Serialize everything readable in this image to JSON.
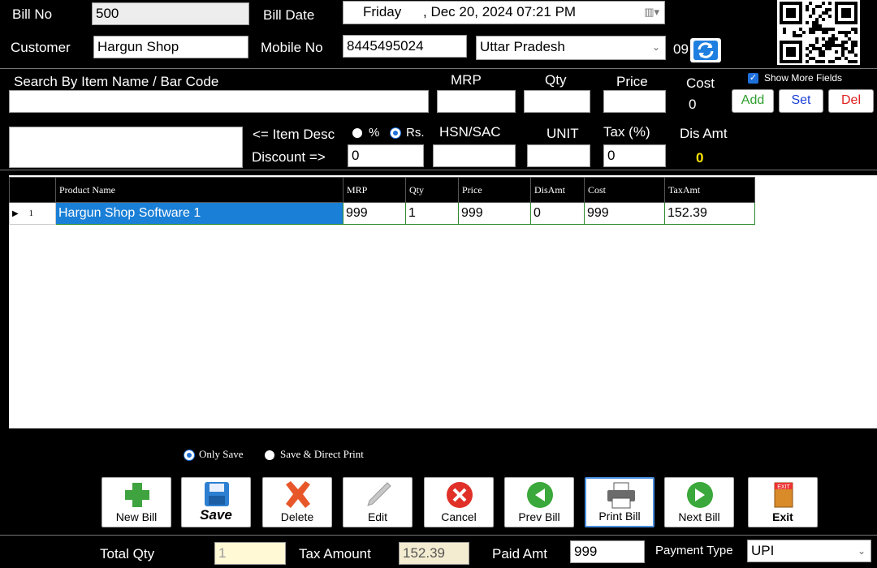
{
  "header": {
    "bill_no_label": "Bill No",
    "bill_no": "500",
    "bill_date_label": "Bill Date",
    "bill_day": "Friday",
    "bill_date": ", Dec 20, 2024 07:21 PM",
    "customer_label": "Customer",
    "customer": "Hargun Shop",
    "mobile_label": "Mobile No",
    "mobile": "8445495024",
    "state": "Uttar Pradesh",
    "state_code": "09"
  },
  "item_entry": {
    "search_label": "Search By Item Name /  Bar Code",
    "mrp_label": "MRP",
    "qty_label": "Qty",
    "price_label": "Price",
    "cost_label": "Cost",
    "cost_value": "0",
    "show_more_label": "Show More Fields",
    "add_label": "Add",
    "set_label": "Set",
    "del_label": "Del",
    "item_desc_label": "<= Item Desc",
    "discount_label": "Discount =>",
    "percent_label": "%",
    "rs_label": "Rs.",
    "discount_value": "0",
    "hsn_label": "HSN/SAC",
    "unit_label": "UNIT",
    "tax_label": "Tax (%)",
    "tax_value": "0",
    "dis_amt_label": "Dis Amt",
    "dis_amt_value": "0"
  },
  "grid": {
    "columns": [
      "Product Name",
      "MRP",
      "Qty",
      "Price",
      "DisAmt",
      "Cost",
      "TaxAmt"
    ],
    "rows": [
      {
        "index": "1",
        "cells": [
          "Hargun Shop Software 1",
          "999",
          "1",
          "999",
          "0",
          "999",
          "152.39"
        ]
      }
    ]
  },
  "save_options": {
    "only_save": "Only Save",
    "save_print": "Save & Direct Print"
  },
  "toolbar": {
    "new_bill": "New Bill",
    "save": "Save",
    "delete": "Delete",
    "edit": "Edit",
    "cancel": "Cancel",
    "prev_bill": "Prev Bill",
    "print_bill": "Print Bill",
    "next_bill": "Next Bill",
    "exit": "Exit",
    "exit_sign": "EXIT"
  },
  "footer": {
    "total_qty_label": "Total Qty",
    "total_qty": "1",
    "tax_amount_label": "Tax Amount",
    "tax_amount": "152.39",
    "paid_amt_label": "Paid Amt",
    "paid_amt": "999",
    "payment_type_label": "Payment Type",
    "payment_type": "UPI"
  },
  "colors": {
    "background": "#000000",
    "selection": "#1a7fd6",
    "add_green": "#2e9e2e",
    "set_blue": "#1a3fd6",
    "del_red": "#e02020",
    "dis_amt_yellow": "#ffe600"
  }
}
